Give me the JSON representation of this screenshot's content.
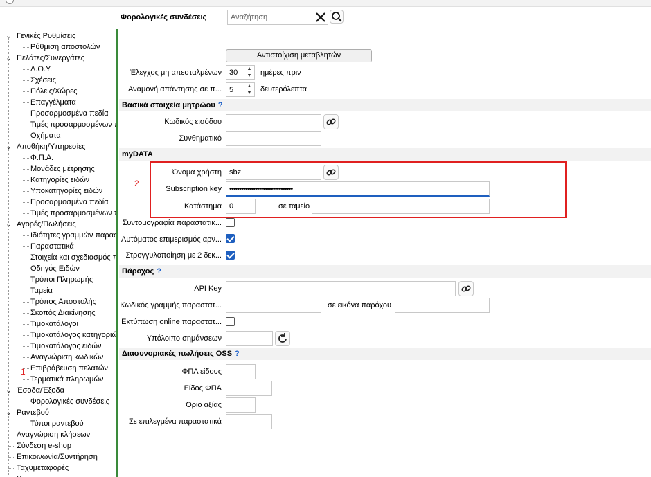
{
  "header": {
    "title": "Φορολογικές συνδέσεις",
    "search_placeholder": "Αναζήτηση"
  },
  "sidebar": {
    "items": [
      {
        "label": "Γενικές Ρυθμίσεις",
        "level": 0,
        "toggle": "minus"
      },
      {
        "label": "Ρύθμιση αποστολών",
        "level": 1
      },
      {
        "label": "Πελάτες/Συνεργάτες",
        "level": 0,
        "toggle": "minus"
      },
      {
        "label": "Δ.Ο.Υ.",
        "level": 1
      },
      {
        "label": "Σχέσεις",
        "level": 1
      },
      {
        "label": "Πόλεις/Χώρες",
        "level": 1
      },
      {
        "label": "Επαγγέλματα",
        "level": 1
      },
      {
        "label": "Προσαρμοσμένα πεδία",
        "level": 1
      },
      {
        "label": "Τιμές προσαρμοσμένων π",
        "level": 1
      },
      {
        "label": "Οχήματα",
        "level": 1
      },
      {
        "label": "Αποθήκη/Υπηρεσίες",
        "level": 0,
        "toggle": "minus"
      },
      {
        "label": "Φ.Π.Α.",
        "level": 1
      },
      {
        "label": "Μονάδες μέτρησης",
        "level": 1
      },
      {
        "label": "Κατηγορίες ειδών",
        "level": 1
      },
      {
        "label": "Υποκατηγορίες ειδών",
        "level": 1
      },
      {
        "label": "Προσαρμοσμένα πεδία",
        "level": 1
      },
      {
        "label": "Τιμές προσαρμοσμένων π",
        "level": 1
      },
      {
        "label": "Αγορές/Πωλήσεις",
        "level": 0,
        "toggle": "minus"
      },
      {
        "label": "Ιδιότητες γραμμών παραστ",
        "level": 1
      },
      {
        "label": "Παραστατικά",
        "level": 1
      },
      {
        "label": "Στοιχεία και σχεδιασμός π",
        "level": 1
      },
      {
        "label": "Οδηγός Ειδών",
        "level": 1
      },
      {
        "label": "Τρόποι Πληρωμής",
        "level": 1
      },
      {
        "label": "Ταμεία",
        "level": 1
      },
      {
        "label": "Τρόπος Αποστολής",
        "level": 1
      },
      {
        "label": "Σκοπός Διακίνησης",
        "level": 1
      },
      {
        "label": "Τιμοκατάλογοι",
        "level": 1
      },
      {
        "label": "Τιμοκατάλογος κατηγοριώ",
        "level": 1
      },
      {
        "label": "Τιμοκατάλογος ειδών",
        "level": 1
      },
      {
        "label": "Αναγνώριση κωδικών",
        "level": 1
      },
      {
        "label": "Επιβράβευση πελατών",
        "level": 1
      },
      {
        "label": "Τερματικά πληρωμών",
        "level": 1
      },
      {
        "label": "Έσοδα/Έξοδα",
        "level": 0,
        "toggle": "minus"
      },
      {
        "label": "Φορολογικές συνδέσεις",
        "level": 1
      },
      {
        "label": "Ραντεβού",
        "level": 0,
        "toggle": "minus"
      },
      {
        "label": "Τύποι ραντεβού",
        "level": 1
      },
      {
        "label": "Αναγνώριση κλήσεων",
        "level": 0
      },
      {
        "label": "Σύνδεση e-shop",
        "level": 0
      },
      {
        "label": "Επικοινωνία/Συντήρηση",
        "level": 0
      },
      {
        "label": "Ταχυμεταφορές",
        "level": 0
      },
      {
        "label": "Υ...",
        "level": 0
      }
    ],
    "annotation": "1"
  },
  "form": {
    "map_button": "Αντιστοίχιση μεταβλητών",
    "unsent_check_label": "Έλεγχος μη απεσταλμένων",
    "unsent_check_value": "30",
    "unsent_check_unit": "ημέρες πριν",
    "response_wait_label": "Αναμονή απάντησης σε π...",
    "response_wait_value": "5",
    "response_wait_unit": "δευτερόλεπτα",
    "registry_section": "Βασικά στοιχεία μητρώου",
    "login_code_label": "Κωδικός εισόδου",
    "login_code_value": "",
    "password_label": "Συνθηματικό",
    "password_value": "",
    "mydata_section": "myDATA",
    "username_label": "Όνομα χρήστη",
    "username_value": "sbz",
    "subscription_label": "Subscription key",
    "subscription_value": "••••••••••••••••••••••••••••••••",
    "store_label": "Κατάστημα",
    "store_value": "0",
    "register_label": "σε ταμείο",
    "register_value": "",
    "annotation": "2",
    "abbrev_label": "Συντομογραφία παραστατικ...",
    "auto_split_label": "Αυτόματος επιμερισμός αρν...",
    "rounding_label": "Στρογγυλοποίηση με 2 δεκ...",
    "provider_section": "Πάροχος",
    "api_key_label": "API Key",
    "api_key_value": "",
    "line_code_label": "Κωδικός γραμμής παραστατ...",
    "line_code_value": "",
    "provider_image_label": "σε εικόνα παρόχου",
    "provider_image_value": "",
    "print_online_label": "Εκτύπωση online παραστατ...",
    "balance_label": "Υπόλοιπο σημάνσεων",
    "balance_value": "",
    "oss_section": "Διασυνοριακές πωλήσεις OSS",
    "vat_item_label": "ΦΠΑ είδους",
    "vat_type_label": "Είδος ΦΠΑ",
    "value_limit_label": "Όριο αξίας",
    "selected_docs_label": "Σε επιλεγμένα παραστατικά",
    "help_mark": "?"
  },
  "checkboxes": {
    "abbrev": false,
    "auto_split": true,
    "rounding": true,
    "print_online": false
  },
  "colors": {
    "accent": "#1e5fbf",
    "annotation_red": "#e02020",
    "sidebar_border": "#3a8a3a",
    "section_bg": "#f2f2f2"
  }
}
